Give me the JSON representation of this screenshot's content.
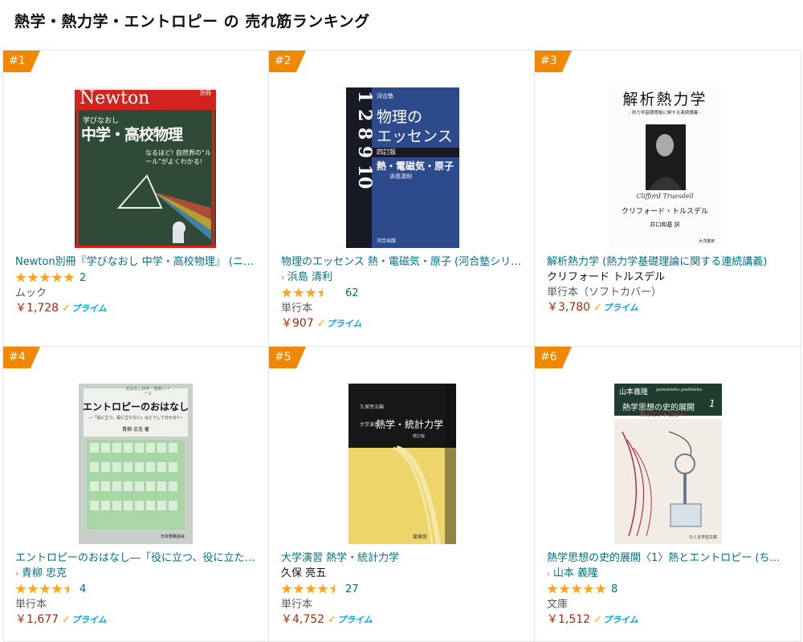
{
  "page_title": "熱学・熱力学・エントロピー の 売れ筋ランキング",
  "items": [
    {
      "rank": "#1",
      "title": "Newton別冊『学びなおし 中学・高校物理』 (ニュ…",
      "author": "",
      "rating": 5,
      "rating_count": "2",
      "format": "ムック",
      "price": "￥1,728",
      "prime": "プライム",
      "cover": {
        "brand": "Newton",
        "tag": "別冊",
        "headline1": "学びなおし",
        "headline2": "中学・高校物理",
        "sub": "なるほど! 自然界の“ルール”がよくわかる!"
      }
    },
    {
      "rank": "#2",
      "title": "物理のエッセンス 熱・電磁気・原子 (河合塾シリ…",
      "author": "浜島 清利",
      "rating": 3.5,
      "rating_count": "62",
      "format": "単行本",
      "price": "￥907",
      "prime": "プライム",
      "cover": {
        "series": "河合塾",
        "heading1": "物理の",
        "heading2": "エッセンス",
        "edition": "四訂版",
        "subtitle": "熱・電磁気・原子",
        "author": "浜島清利",
        "publisher": "河合出版",
        "numbers": "1 2 8 9 10"
      }
    },
    {
      "rank": "#3",
      "title": "解析熱力学 (熱力学基礎理論に関する連続講義)",
      "author": "クリフォード トルスデル",
      "rating": 0,
      "rating_count": "",
      "format": "単行本（ソフトカバー）",
      "price": "￥3,780",
      "prime": "プライム",
      "cover": {
        "title": "解析熱力学",
        "subtitle": "- 熱力学基礎理論に関する連続講義 -",
        "signature": "Clifford Truesdell",
        "author": "クリフォード・トルスデル",
        "translator": "井口和基 訳",
        "publisher": "大洋書房"
      }
    },
    {
      "rank": "#4",
      "title": "エントロピーのおはなし―「役に立つ、役に立た…",
      "author": "青柳 忠克",
      "rating": 4.5,
      "rating_count": "4",
      "format": "単行本",
      "price": "￥1,677",
      "prime": "プライム",
      "cover": {
        "series": "おはなし科学・技術シリーズ",
        "title": "エントロピーのおはなし",
        "sub": "—「役に立つ、役に立たない」はどうして分かる?—",
        "author": "青柳 忠克 著",
        "publisher": "日本規格協会"
      }
    },
    {
      "rank": "#5",
      "title": "大学演習 熱学・統計力学",
      "author": "久保 亮五",
      "rating": 4.5,
      "rating_count": "27",
      "format": "単行本",
      "price": "￥4,752",
      "prime": "プライム",
      "cover": {
        "editor": "久保亮五編",
        "series": "大学演習",
        "title": "熱学・統計力学",
        "edition": "修訂版",
        "publisher": "裳華房"
      }
    },
    {
      "rank": "#6",
      "title": "熱学思想の史的展開〈1〉熱とエントロピー (ち…",
      "author": "山本 義隆",
      "rating": 5,
      "rating_count": "8",
      "format": "文庫",
      "price": "￥1,512",
      "prime": "プライム",
      "cover": {
        "author": "山本義隆",
        "author_en": "yamamoto yoshitaka",
        "title": "熱学思想の史的展開",
        "volume": "1",
        "sub": "熱とエントロピー",
        "publisher": "ちくま学芸文庫"
      }
    }
  ]
}
